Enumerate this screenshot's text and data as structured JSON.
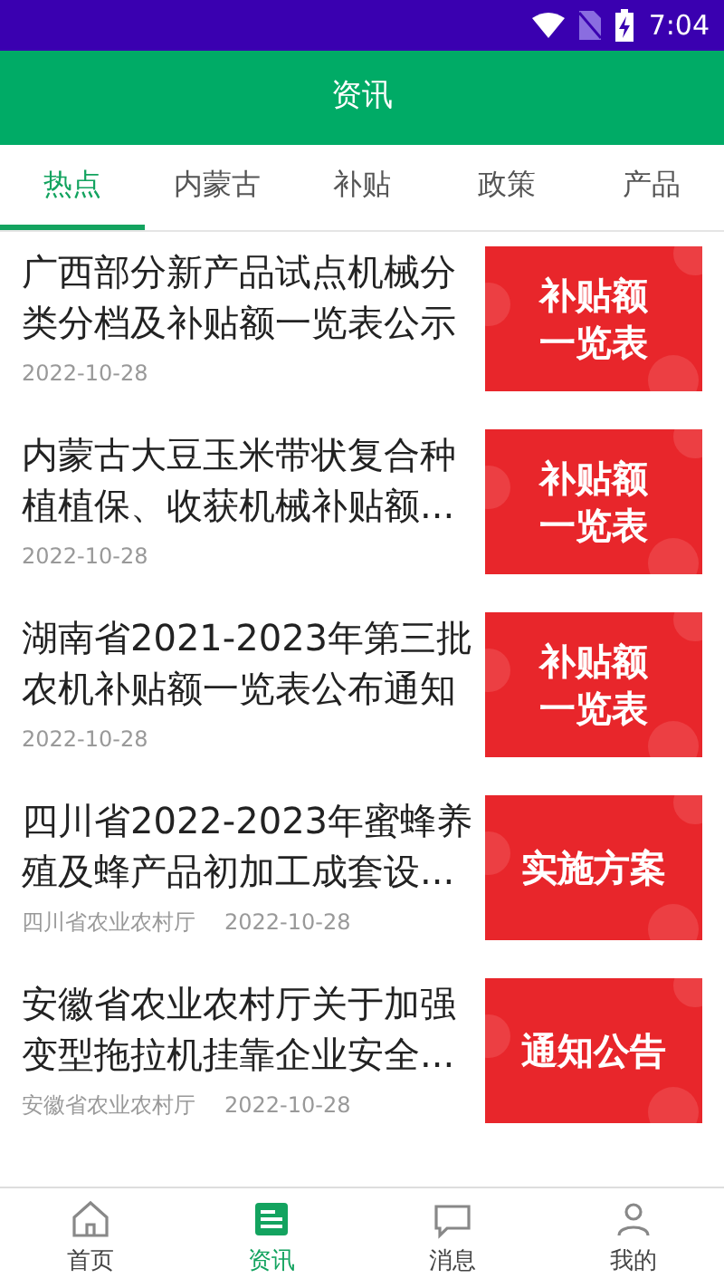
{
  "status_bar": {
    "time": "7:04"
  },
  "header": {
    "title": "资讯"
  },
  "tabs": [
    {
      "label": "热点",
      "selected": true
    },
    {
      "label": "内蒙古",
      "selected": false
    },
    {
      "label": "补贴",
      "selected": false
    },
    {
      "label": "政策",
      "selected": false
    },
    {
      "label": "产品",
      "selected": false
    }
  ],
  "articles": [
    {
      "title": "广西部分新产品试点机械分类分档及补贴额一览表公示",
      "date": "2022-10-28",
      "thumbnail_lines": [
        "补贴额",
        "一览表"
      ]
    },
    {
      "title": "内蒙古大豆玉米带状复合种植植保、收获机械补贴额...",
      "date": "2022-10-28",
      "thumbnail_lines": [
        "补贴额",
        "一览表"
      ]
    },
    {
      "title": "湖南省2021-2023年第三批农机补贴额一览表公布通知",
      "date": "2022-10-28",
      "thumbnail_lines": [
        "补贴额",
        "一览表"
      ]
    },
    {
      "title": "四川省2022-2023年蜜蜂养殖及蜂产品初加工成套设...",
      "source": "四川省农业农村厅",
      "date": "2022-10-28",
      "thumbnail_lines": [
        "实施方案"
      ]
    },
    {
      "title": "安徽省农业农村厅关于加强变型拖拉机挂靠企业安全...",
      "source": "安徽省农业农村厅",
      "date": "2022-10-28",
      "thumbnail_lines": [
        "通知公告"
      ]
    }
  ],
  "bottom_nav": [
    {
      "label": "首页",
      "kind": "home",
      "selected": false
    },
    {
      "label": "资讯",
      "kind": "news",
      "selected": true
    },
    {
      "label": "消息",
      "kind": "message",
      "selected": false
    },
    {
      "label": "我的",
      "kind": "profile",
      "selected": false
    }
  ]
}
